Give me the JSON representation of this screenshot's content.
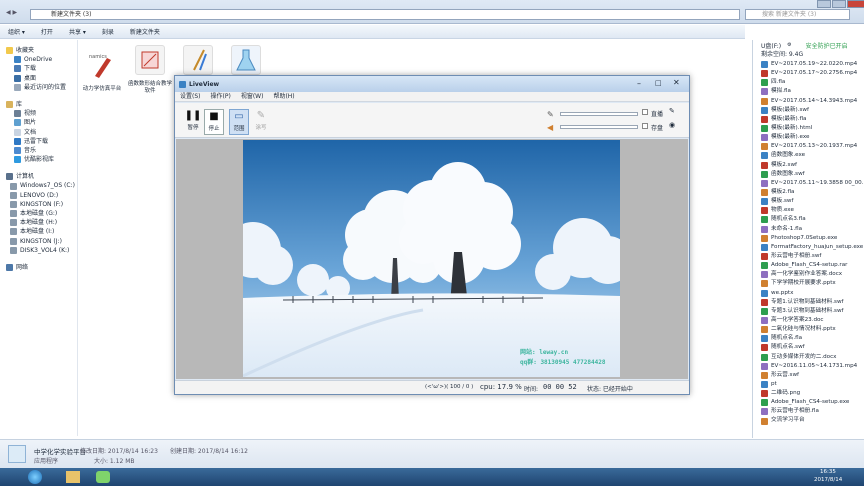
{
  "explorer": {
    "address": "新建文件夹 (3)",
    "search_placeholder": "搜索 新建文件夹 (3)",
    "toolbar": [
      "组织 ▾",
      "打开",
      "共享 ▾",
      "刻录",
      "新建文件夹"
    ],
    "nav": {
      "favorites": [
        "收藏夹",
        "OneDrive",
        "下载",
        "桌面",
        "最近访问的位置"
      ],
      "library": [
        "库",
        "视频",
        "图片",
        "文档",
        "迅雷下载",
        "音乐",
        "优酷影视库"
      ],
      "computer": [
        "计算机",
        "Windows7_OS (C:)",
        "LENOVO (D:)",
        "KINGSTON (F:)",
        "本地磁盘 (G:)",
        "本地磁盘 (H:)",
        "本地磁盘 (I:)",
        "KINGSTON (J:)",
        "DISK3_VOL4 (K:)"
      ],
      "network": "网络"
    },
    "files": [
      {
        "name": "动力学仿真平台",
        "thumb_text": "namics"
      },
      {
        "name": "函数数形结合教学软件",
        "thumb_text": ""
      },
      {
        "name": "",
        "thumb_text": ""
      },
      {
        "name": "",
        "thumb_text": ""
      }
    ],
    "details": {
      "name": "中学化学实验平台",
      "type": "应用程序",
      "modified": "修改日期: 2017/8/14 16:23",
      "created": "创建日期: 2017/8/14 16:12",
      "size": "大小: 1.12 MB"
    }
  },
  "usb_panel": {
    "title": "U盘(F:)",
    "protect": "安全防护已开启",
    "free": "剩余空间: 9.4G",
    "files": [
      "EV~2017.05.19~22.0220.mp4",
      "EV~2017.05.17~20.2756.mp4",
      "四.fla",
      "模拟.fla",
      "EV~2017.05.14~14.3943.mp4",
      "模板(最新).swf",
      "模板(最新).fla",
      "模板(最新).html",
      "模板(最新).exe",
      "EV~2017.05.13~20.1937.mp4",
      "函数图象.exe",
      "模板2.swf",
      "函数图象.swf",
      "EV~2017.05.11~19.3858 00_00...",
      "模板2.fla",
      "模板.swf",
      "物质.exe",
      "随机点名3.fla",
      "未命名-1.fla",
      "Photoshop7.0Setup.exe",
      "FormatFactory_huajun_setup.exe",
      "形云营电子相册.swf",
      "Adobe_Flash_CS4-setup.rar",
      "高一化学鉴别作业答案.docx",
      "下学学期校开展要求.pptx",
      "we.pptx",
      "专题1.认识物到基础材料.swf",
      "专题3.认识物到基础材料.swf",
      "高一化学答案23.doc",
      "二氧化硅与情况材料.pptx",
      "随机点名.fla",
      "随机点名.swf",
      "互动多媒体开发的二.docx",
      "EV~2016.11.05~14.1731.mp4",
      "形云营.swf",
      "pt",
      "二维码.png",
      "Adobe_Flash_CS4-setup.exe",
      "形云营电子相册.fla",
      "交流学习平台"
    ]
  },
  "liveview": {
    "title": "LiveView",
    "menu": [
      "设置(S)",
      "操作(P)",
      "视窗(W)",
      "帮助(H)"
    ],
    "tools": [
      {
        "glyph": "❚❚",
        "label": "暂停"
      },
      {
        "glyph": "■",
        "label": "停止"
      },
      {
        "glyph": "▭",
        "label": "范围"
      },
      {
        "glyph": "✎",
        "label": "涂写"
      }
    ],
    "checkbox_labels": [
      "直播",
      "存盘"
    ],
    "watermark": {
      "site": "网站: leway.cn",
      "qq": "qq群: 38130945  477284428"
    },
    "status": {
      "frames": "(<'ω'>)( 100 / 0 )",
      "cpu": "cpu: 17.9 %",
      "time_label": "时间:",
      "time_value": "00 00 52",
      "state": "状态: 已经开始中"
    }
  },
  "taskbar": {
    "time": "16:35",
    "date": "2017/8/14"
  }
}
